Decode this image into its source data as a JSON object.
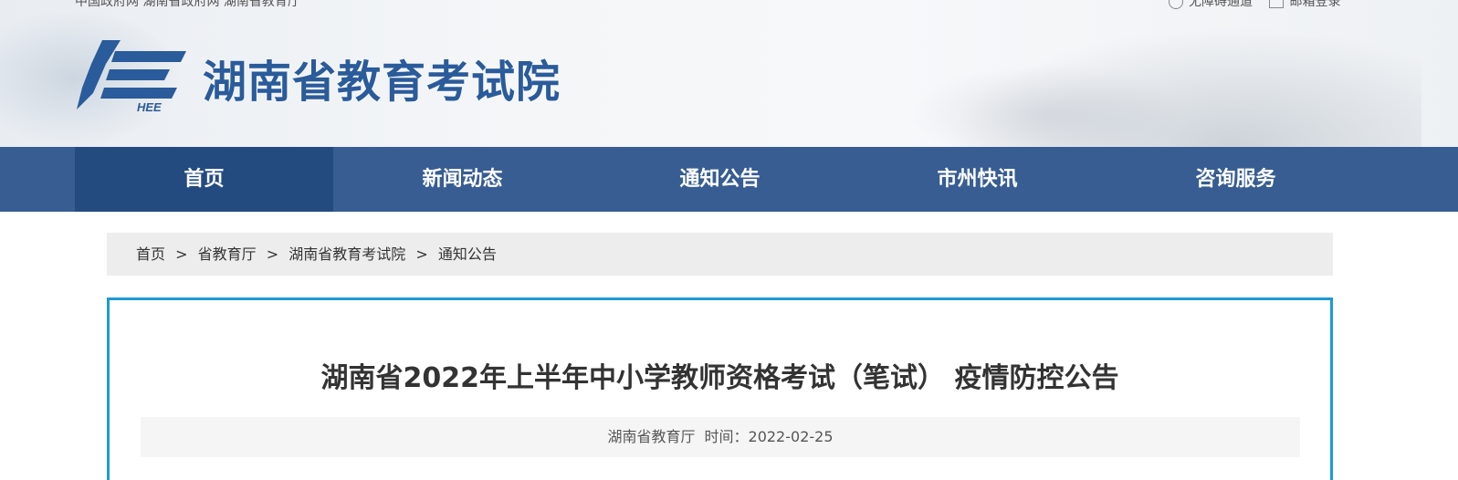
{
  "header": {
    "top_links": [
      "中国政府网",
      "湖南省政府网",
      "湖南省教育厅"
    ],
    "top_right": {
      "accessibility": "无障碍通道",
      "email_login": "邮箱登录"
    },
    "logo_text": "HEE",
    "site_title": "湖南省教育考试院"
  },
  "nav": {
    "items": [
      {
        "label": "首页"
      },
      {
        "label": "新闻动态"
      },
      {
        "label": "通知公告"
      },
      {
        "label": "市州快讯"
      },
      {
        "label": "咨询服务"
      }
    ]
  },
  "breadcrumb": {
    "items": [
      "首页",
      "省教育厅",
      "湖南省教育考试院",
      "通知公告"
    ],
    "separator": ">"
  },
  "article": {
    "title": "湖南省2022年上半年中小学教师资格考试（笔试） 疫情防控公告",
    "source": "湖南省教育厅",
    "time_label": "时间：",
    "date": "2022-02-25"
  },
  "colors": {
    "nav_bg": "#375d92",
    "nav_active_bg": "#244b80",
    "brand_blue": "#2a5b9a",
    "panel_border": "#1e9ad3"
  }
}
